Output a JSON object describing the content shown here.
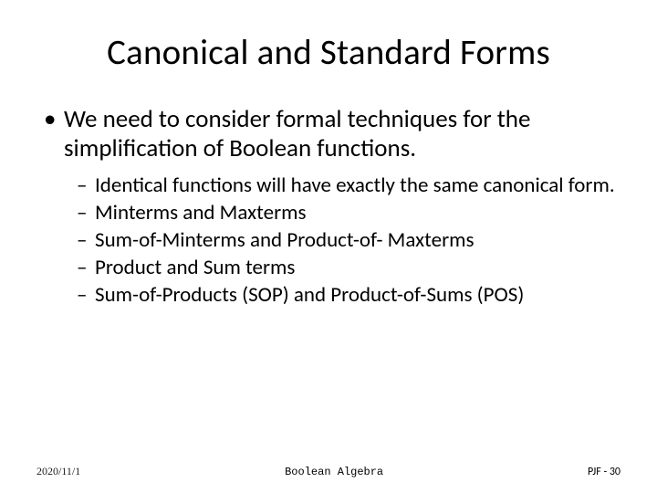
{
  "title": "Canonical and Standard Forms",
  "bullets": {
    "main": "We need to consider formal techniques for the simplification of Boolean functions.",
    "subs": [
      "Identical functions will have exactly the same canonical form.",
      "Minterms and Maxterms",
      "Sum-of-Minterms and Product-of- Maxterms",
      "Product and Sum terms",
      "Sum-of-Products (SOP) and Product-of-Sums (POS)"
    ]
  },
  "footer": {
    "date": "2020/11/1",
    "subject": "Boolean Algebra",
    "page": "PJF - 30"
  }
}
